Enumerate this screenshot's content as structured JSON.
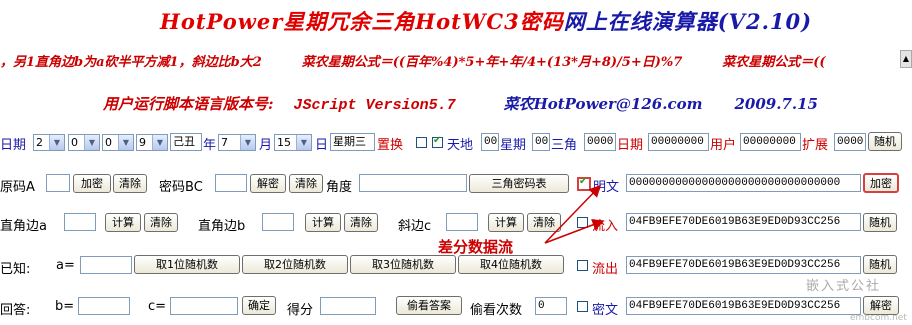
{
  "title": {
    "part1": "HotPower星期冗余三角HotWC3密码",
    "part2": "网上在线演算器(V2.10)"
  },
  "marquee": {
    "text_a": "，另1直角边b为a砍半平方减1，斜边比b大2",
    "text_b": "菜农星期公式＝((百年%4)*5+年+年/4+(13*月+8)/5+日)%7",
    "text_c": "菜农星期公式＝((",
    "scroll_icon": "scroll-arrow-icon"
  },
  "version": {
    "label": "用户运行脚本语言版本号:",
    "value": "JScript Version5.7",
    "email": "菜农HotPower@126.com",
    "date": "2009.7.15"
  },
  "row1": {
    "date_label": "日期",
    "d1": "2",
    "d2": "0",
    "d3": "0",
    "d4": "9",
    "ganzhi": "己丑",
    "year_label": "年",
    "month": "7",
    "month_label": "月",
    "day": "15",
    "day_label": "日",
    "weekday": "星期三",
    "replace_label": "置换",
    "tiandi_label": "天地",
    "tiandi_value": "00",
    "xingqi_label": "星期",
    "xingqi_value": "00",
    "sanjiao_label": "三角",
    "sanjiao_value": "0000",
    "riqi_label": "日期",
    "riqi_value": "00000000",
    "user_label": "用户",
    "user_value": "00000000",
    "ext_label": "扩展",
    "ext_value": "0000",
    "random_label": "随机"
  },
  "row2": {
    "orig_label": "原码A",
    "encrypt_label": "加密",
    "clear1_label": "清除",
    "cipher_label": "密码BC",
    "decrypt_label": "解密",
    "clear2_label": "清除",
    "angle_label": "角度",
    "table_label": "三角密码表",
    "plain_label": "明文",
    "plain_value": "00000000000000000000000000000000",
    "encrypt2_label": "加密"
  },
  "row3": {
    "leg_a_label": "直角边a",
    "calc1": "计算",
    "clear1": "清除",
    "leg_b_label": "直角边b",
    "calc2": "计算",
    "clear2": "清除",
    "hyp_label": "斜边c",
    "calc3": "计算",
    "clear3": "清除",
    "inflow_label": "流入",
    "inflow_value": "04FB9EFE70DE6019B63E9ED0D93CC256",
    "random_label": "随机"
  },
  "annotation": {
    "text": "差分数据流"
  },
  "row4": {
    "known_label": "已知:",
    "a_label": "a=",
    "rand1": "取1位随机数",
    "rand2": "取2位随机数",
    "rand3": "取3位随机数",
    "rand4": "取4位随机数",
    "outflow_label": "流出",
    "outflow_value": "04FB9EFE70DE6019B63E9ED0D93CC256",
    "random_label": "随机"
  },
  "row5": {
    "answer_label": "回答:",
    "b_label": "b=",
    "c_label": "c=",
    "confirm": "确定",
    "score_label": "得分",
    "peek_label": "偷看答案",
    "peek_count_label": "偷看次数",
    "peek_count": "0",
    "cipher_label": "密文",
    "cipher_value": "04FB9EFE70DE6019B63E9ED0D93CC256",
    "decrypt_label": "解密"
  },
  "watermark": {
    "text1": "嵌入式公社",
    "text2": "embcom.net"
  },
  "colors": {
    "title_red": "#e00000",
    "title_blue": "#1a1aa8",
    "label_blue": "#1a1aa8",
    "label_red": "#cc0000"
  }
}
